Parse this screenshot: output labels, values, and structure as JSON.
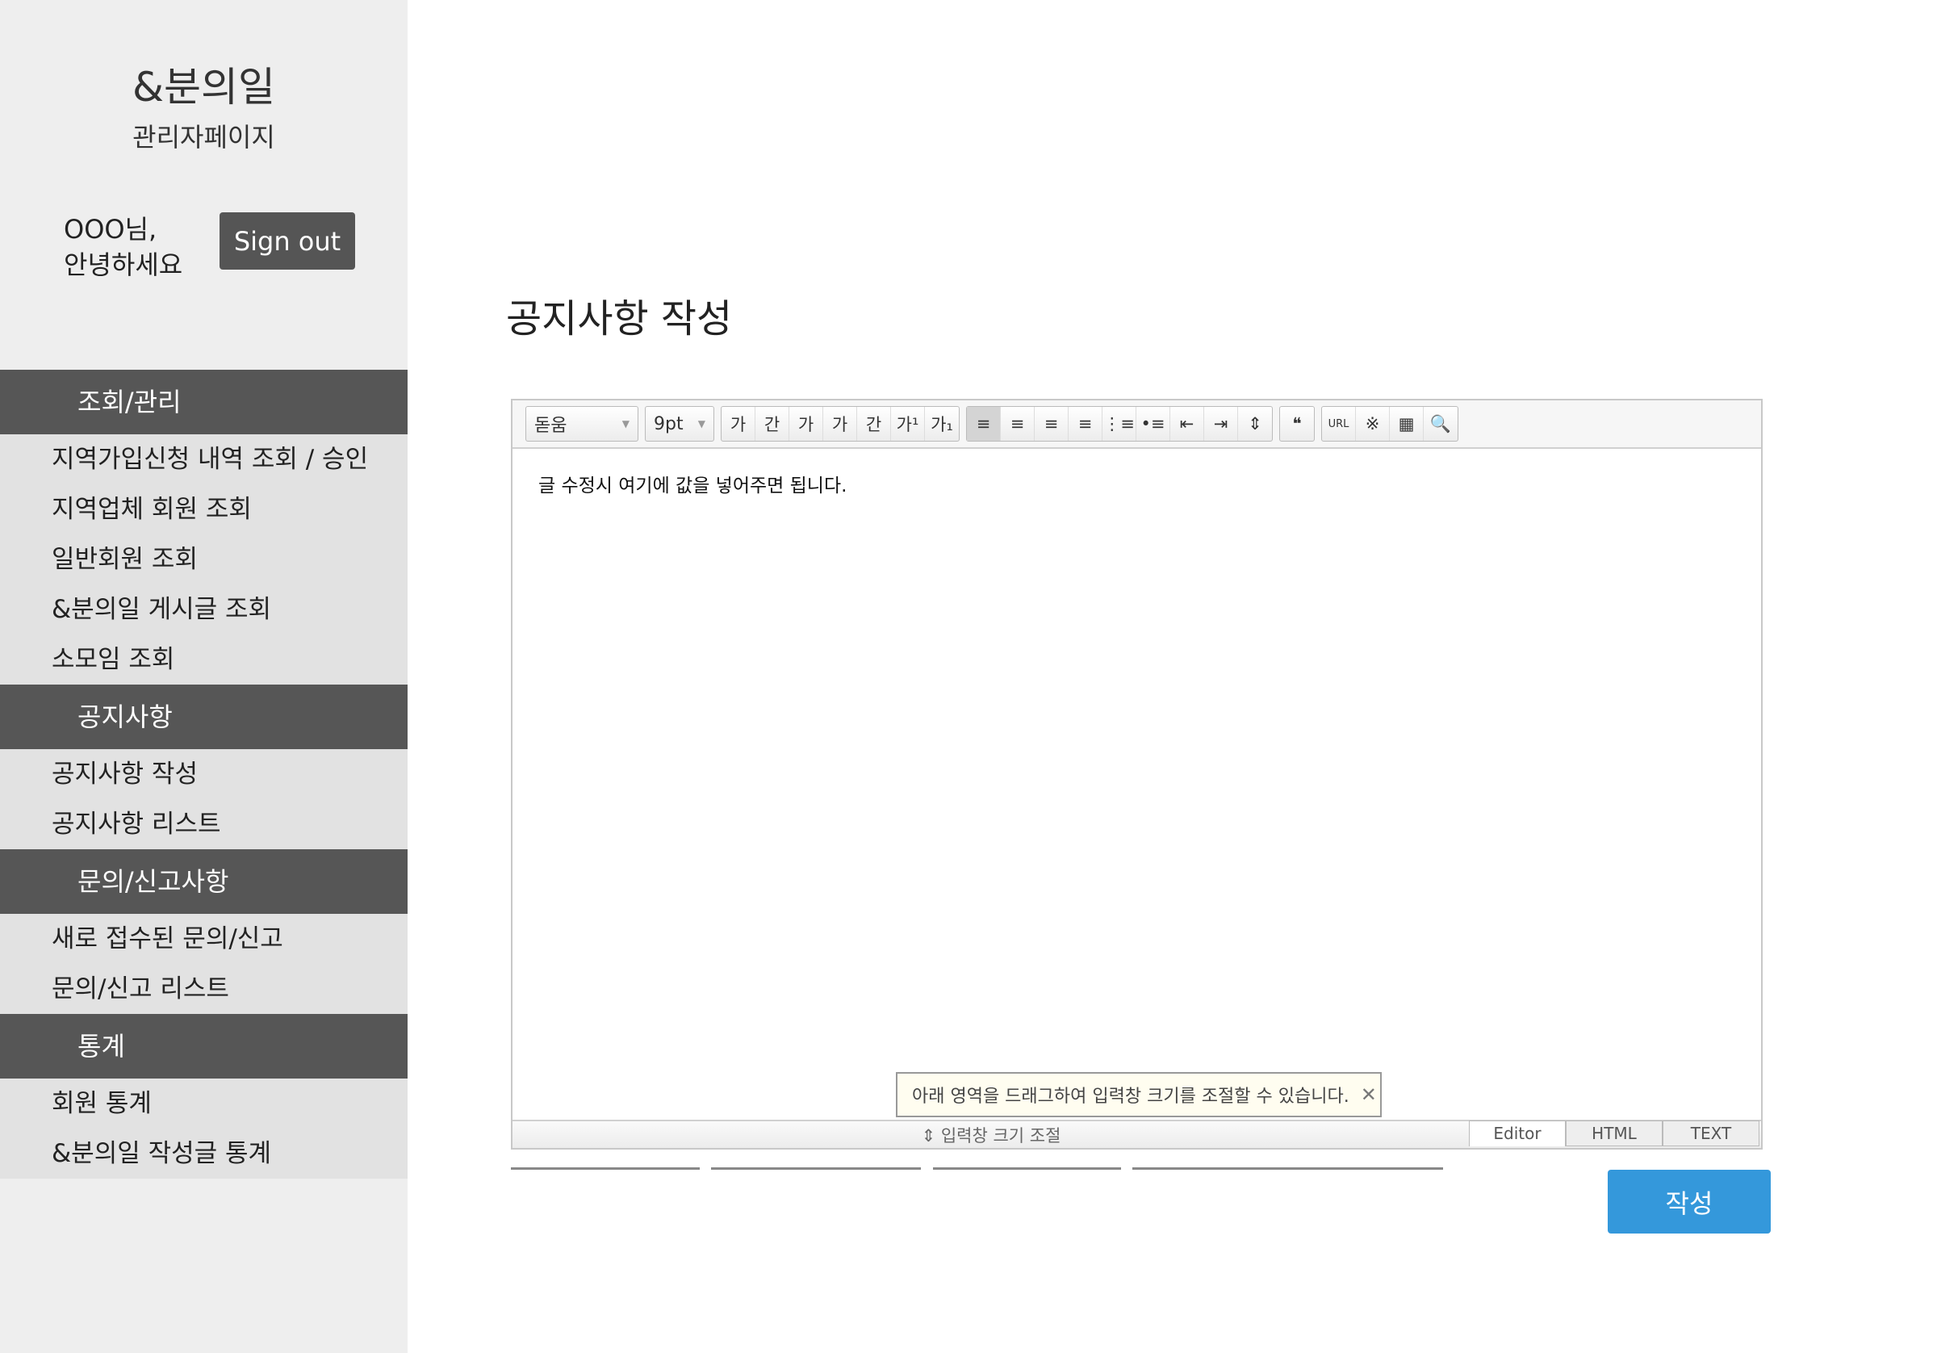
{
  "sidebar": {
    "logo": "&분의일",
    "subtitle": "관리자페이지",
    "greeting_line1": "OOO님,",
    "greeting_line2": "안녕하세요",
    "signout": "Sign out",
    "sections": [
      {
        "header": "조회/관리",
        "items": [
          "지역가입신청 내역 조회 / 승인",
          "지역업체 회원 조회",
          "일반회원 조회",
          "&분의일 게시글 조회",
          "소모임 조회"
        ]
      },
      {
        "header": "공지사항",
        "items": [
          "공지사항 작성",
          "공지사항 리스트"
        ]
      },
      {
        "header": "문의/신고사항",
        "items": [
          "새로 접수된 문의/신고",
          "문의/신고 리스트"
        ]
      },
      {
        "header": "통계",
        "items": [
          "회원 통계",
          "&분의일 작성글 통계"
        ]
      }
    ]
  },
  "main": {
    "title": "공지사항 작성",
    "editor": {
      "font": "돋움",
      "size": "9pt",
      "buttons": [
        "가",
        "간",
        "가",
        "가",
        "간",
        "가¹",
        "가₁",
        "≡",
        "≡",
        "≡",
        "≡",
        "⋮≡",
        "•≡",
        "⇤",
        "⇥",
        "⇕",
        "❝",
        "URL",
        "※",
        "▦",
        "🔍"
      ],
      "content": "글 수정시 여기에 값을 넣어주면 됩니다.",
      "tooltip": "아래 영역을 드래그하여 입력창 크기를 조절할 수 있습니다.",
      "resize_label": "⇕ 입력창 크기 조절",
      "tabs": [
        "Editor",
        "HTML",
        "TEXT"
      ],
      "active_tab": "Editor"
    },
    "submit": "작성"
  },
  "colors": {
    "sidebar_header": "#565656",
    "submit": "#3498db"
  }
}
